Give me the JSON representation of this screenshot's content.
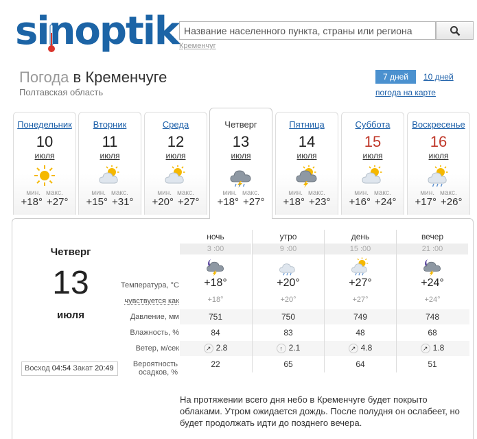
{
  "logo": {
    "text": "sinoptik"
  },
  "search": {
    "placeholder": "Название населенного пункта, страны или региона",
    "hint": "Кременчуг"
  },
  "header": {
    "title_prefix": "Погода",
    "title_city": "в Кременчуге",
    "region": "Полтавская область"
  },
  "toggle": {
    "seven": "7 дней",
    "ten": "10 дней",
    "map": "погода на карте"
  },
  "days": [
    {
      "name": "Понедельник",
      "num": "10",
      "month": "июля",
      "min_label": "мин.",
      "max_label": "макс.",
      "min": "+18°",
      "max": "+27°",
      "icon": "sun-icon",
      "weekend": false
    },
    {
      "name": "Вторник",
      "num": "11",
      "month": "июля",
      "min_label": "мин.",
      "max_label": "макс.",
      "min": "+15°",
      "max": "+31°",
      "icon": "partly-cloudy-icon",
      "weekend": false
    },
    {
      "name": "Среда",
      "num": "12",
      "month": "июля",
      "min_label": "мин.",
      "max_label": "макс.",
      "min": "+20°",
      "max": "+27°",
      "icon": "partly-cloudy-icon",
      "weekend": false
    },
    {
      "name": "Четверг",
      "num": "13",
      "month": "июля",
      "min_label": "мин.",
      "max_label": "макс.",
      "min": "+18°",
      "max": "+27°",
      "icon": "cloud-storm-icon",
      "weekend": false
    },
    {
      "name": "Пятница",
      "num": "14",
      "month": "июля",
      "min_label": "мин.",
      "max_label": "макс.",
      "min": "+18°",
      "max": "+23°",
      "icon": "sun-cloud-storm-icon",
      "weekend": false
    },
    {
      "name": "Суббота",
      "num": "15",
      "month": "июля",
      "min_label": "мин.",
      "max_label": "макс.",
      "min": "+16°",
      "max": "+24°",
      "icon": "partly-cloudy-icon",
      "weekend": true
    },
    {
      "name": "Воскресенье",
      "num": "16",
      "month": "июля",
      "min_label": "мин.",
      "max_label": "макс.",
      "min": "+17°",
      "max": "+26°",
      "icon": "sun-cloud-rain-icon",
      "weekend": true
    }
  ],
  "detail": {
    "day_name": "Четверг",
    "day_num": "13",
    "month": "июля",
    "sunrise_label": "Восход",
    "sunrise": "04:54",
    "sunset_label": "Закат",
    "sunset": "20:49",
    "labels": {
      "temp": "Температура, °С",
      "feels": "чувствуется как",
      "pressure": "Давление, мм",
      "humidity": "Влажность, %",
      "wind": "Ветер, м/сек",
      "precip": "Вероятность осадков, %"
    },
    "periods": [
      {
        "name": "ночь",
        "time": "3 :00",
        "icon": "night-cloud-storm-icon",
        "temp": "+18°",
        "feels": "+18°",
        "pressure": "751",
        "humidity": "84",
        "wind_dir": "↗",
        "wind": "2.8",
        "precip": "22"
      },
      {
        "name": "утро",
        "time": "9 :00",
        "icon": "cloud-drizzle-icon",
        "temp": "+20°",
        "feels": "+20°",
        "pressure": "750",
        "humidity": "83",
        "wind_dir": "↑",
        "wind": "2.1",
        "precip": "65"
      },
      {
        "name": "день",
        "time": "15 :00",
        "icon": "sun-cloud-drizzle-icon",
        "temp": "+27°",
        "feels": "+27°",
        "pressure": "749",
        "humidity": "48",
        "wind_dir": "↗",
        "wind": "4.8",
        "precip": "64"
      },
      {
        "name": "вечер",
        "time": "21 :00",
        "icon": "night-cloud-storm-icon",
        "temp": "+24°",
        "feels": "+24°",
        "pressure": "748",
        "humidity": "68",
        "wind_dir": "↗",
        "wind": "1.8",
        "precip": "51"
      }
    ],
    "description": "На протяжении всего дня небо в Кременчуге будет покрыто облаками. Утром ожидается дождь. После полудня он ослабеет, но будет продолжать идти до позднего вечера."
  },
  "colors": {
    "brand": "#1c64a6",
    "accent": "#4b91cf",
    "link": "#1a5ea8",
    "weekend": "#c0392b"
  }
}
